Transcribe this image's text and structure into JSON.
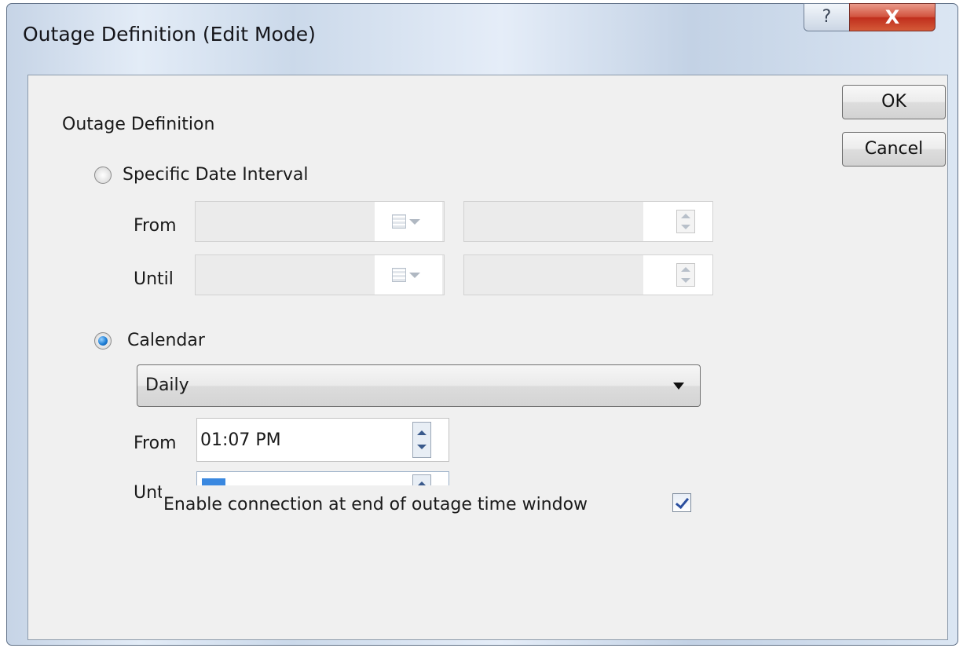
{
  "window": {
    "title": "Outage Definition (Edit Mode)",
    "help_glyph": "?",
    "close_glyph": "X"
  },
  "buttons": {
    "ok": "OK",
    "cancel": "Cancel"
  },
  "group_label": "Outage Definition",
  "specific_interval": {
    "label": "Specific Date Interval",
    "selected": false,
    "from_label": "From",
    "until_label": "Until"
  },
  "calendar": {
    "label": "Calendar",
    "selected": true,
    "frequency": "Daily",
    "from_label": "From",
    "from_time": "01:07 PM",
    "until_label_partial": "Unt"
  },
  "enable_connection": {
    "label": "Enable connection at end of outage time window",
    "checked": true
  },
  "colors": {
    "close_button": "#c7432f",
    "radio_selected": "#1f7fd6",
    "frame": "#cbd9ea"
  }
}
